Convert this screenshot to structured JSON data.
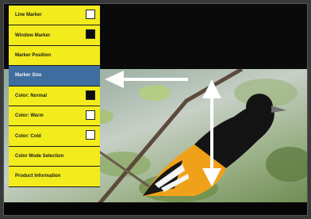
{
  "menu": {
    "items": [
      {
        "label": "Line Marker",
        "swatch": "white"
      },
      {
        "label": "Window Marker",
        "swatch": "black"
      },
      {
        "label": "Marker Position",
        "swatch": ""
      },
      {
        "label": "Marker Size",
        "swatch": "",
        "selected": true
      },
      {
        "label": "Color: Normal",
        "swatch": "black"
      },
      {
        "label": "Color: Warm",
        "swatch": "white"
      },
      {
        "label": "Color: Cold",
        "swatch": "white"
      },
      {
        "label": "Color Mode Selection",
        "swatch": ""
      },
      {
        "label": "Product Information",
        "swatch": ""
      }
    ]
  },
  "colors": {
    "menu_bg": "#f2ec1d",
    "selected_bg": "#3d6e9f",
    "arrow": "#ffffff"
  }
}
